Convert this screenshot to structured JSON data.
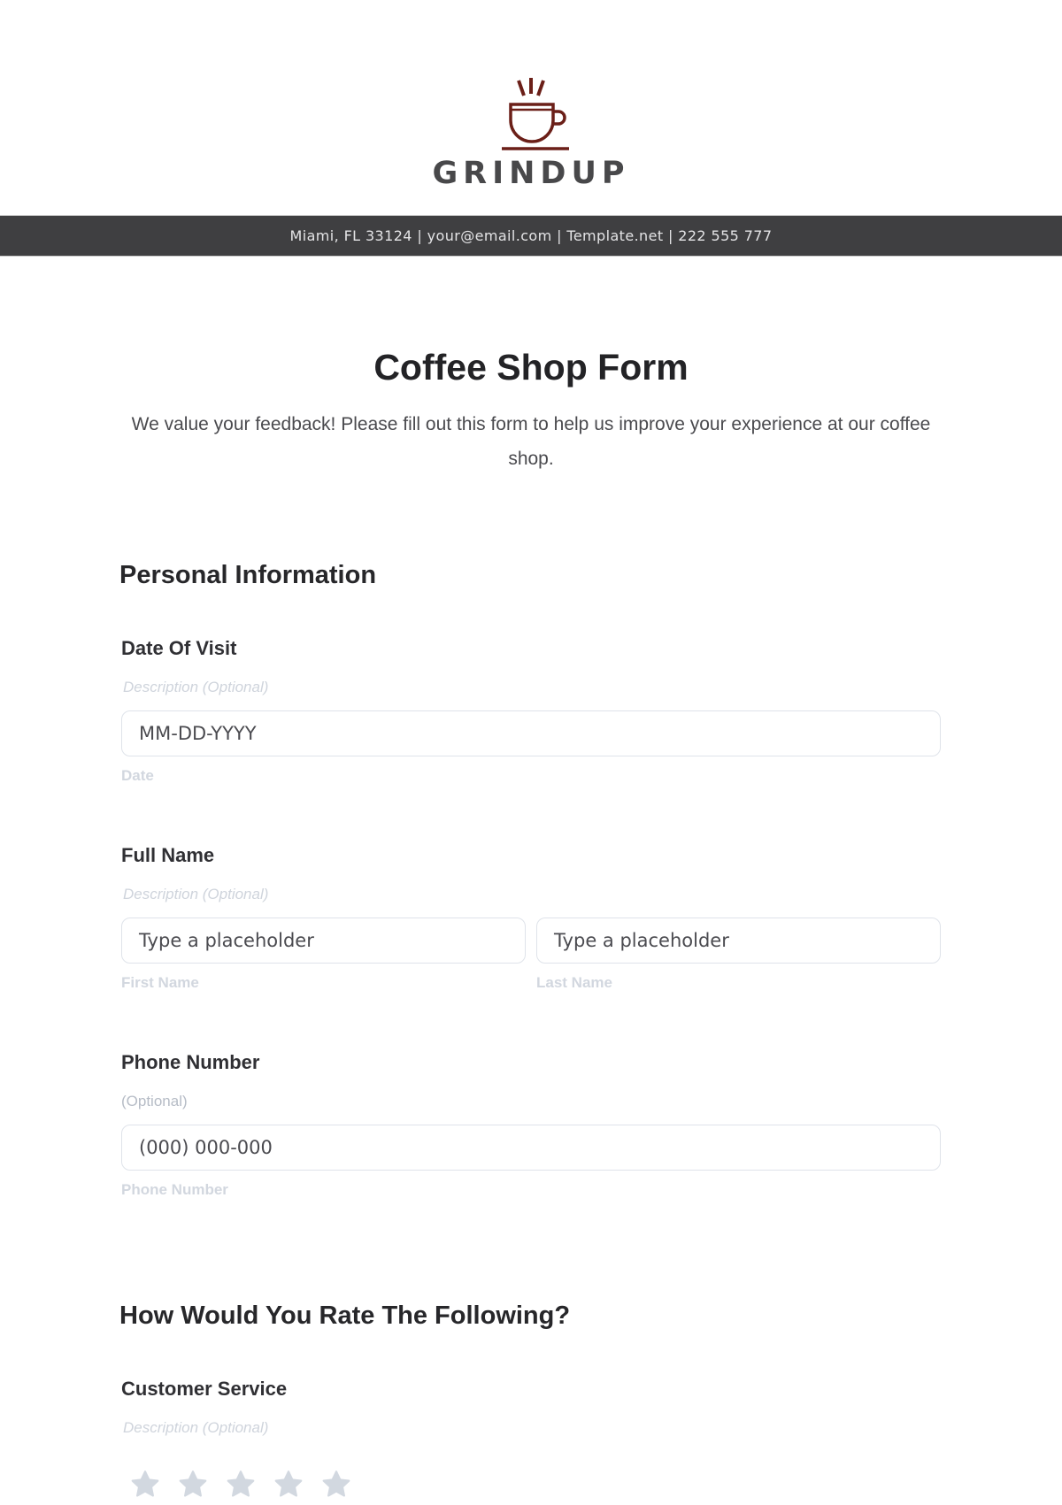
{
  "header": {
    "logo_icon": "coffee-cup-icon",
    "brand_name": "GRINDUP",
    "brand_color": "#6b1f18",
    "contact_line": "Miami, FL 33124 | your@email.com | Template.net | 222 555 777"
  },
  "form": {
    "title": "Coffee Shop Form",
    "description": "We value your feedback! Please fill out this form to help us improve your experience at our coffee shop."
  },
  "sections": [
    {
      "title": "Personal Information",
      "fields": [
        {
          "label": "Date Of Visit",
          "description": "Description (Optional)",
          "placeholder": "MM-DD-YYYY",
          "sub_label": "Date"
        },
        {
          "label": "Full Name",
          "description": "Description (Optional)",
          "inputs": [
            {
              "placeholder": "Type a placeholder",
              "sub_label": "First Name"
            },
            {
              "placeholder": "Type a placeholder",
              "sub_label": "Last Name"
            }
          ]
        },
        {
          "label": "Phone Number",
          "description": "(Optional)",
          "placeholder": "(000) 000-000",
          "sub_label": "Phone Number"
        }
      ]
    },
    {
      "title": "How Would You Rate The Following?",
      "fields": [
        {
          "label": "Customer Service",
          "description": "Description (Optional)",
          "rating": {
            "value": 0,
            "max": 5,
            "icon": "star-icon",
            "empty_color": "#d2d8e0"
          }
        }
      ]
    }
  ]
}
